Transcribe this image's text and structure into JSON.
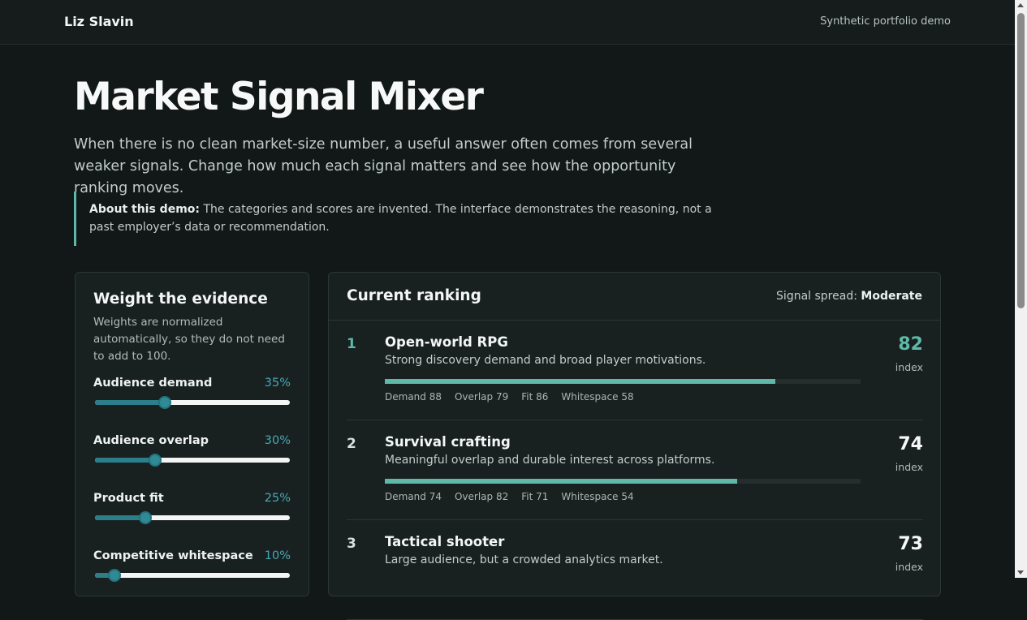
{
  "header": {
    "brand": "Liz Slavin",
    "tagline": "Synthetic portfolio demo"
  },
  "hero": {
    "title": "Market Signal Mixer",
    "lede": "When there is no clean market-size number, a useful answer often comes from several weaker signals. Change how much each signal matters and see how the opportunity ranking moves.",
    "note_label": "About this demo:",
    "note_text": " The categories and scores are invented. The interface demonstrates the reasoning, not a past employer’s data or recommendation."
  },
  "weights": {
    "title": "Weight the evidence",
    "description": "Weights are normalized automatically, so they do not need to add to 100.",
    "sliders": [
      {
        "label": "Audience demand",
        "pct_text": "35%",
        "level": 0.36
      },
      {
        "label": "Audience overlap",
        "pct_text": "30%",
        "level": 0.31
      },
      {
        "label": "Product fit",
        "pct_text": "25%",
        "level": 0.26
      },
      {
        "label": "Competitive whitespace",
        "pct_text": "10%",
        "level": 0.1
      }
    ]
  },
  "ranking": {
    "title": "Current ranking",
    "spread_label": "Signal spread: ",
    "spread_value": "Moderate",
    "index_label": "index",
    "items": [
      {
        "rank": "1",
        "name": "Open-world RPG",
        "description": "Strong discovery demand and broad player motivations.",
        "score": "82",
        "score_fraction": 0.82,
        "highlight": true,
        "metrics": [
          "Demand 88",
          "Overlap 79",
          "Fit 86",
          "Whitespace 58"
        ]
      },
      {
        "rank": "2",
        "name": "Survival crafting",
        "description": "Meaningful overlap and durable interest across platforms.",
        "score": "74",
        "score_fraction": 0.74,
        "highlight": false,
        "metrics": [
          "Demand 74",
          "Overlap 82",
          "Fit 71",
          "Whitespace 54"
        ]
      },
      {
        "rank": "3",
        "name": "Tactical shooter",
        "description": "Large audience, but a crowded analytics market.",
        "score": "73",
        "score_fraction": 0.73,
        "highlight": false,
        "metrics": []
      }
    ]
  },
  "colors": {
    "accent": "#5fb8a8",
    "slider_accent": "#2b7e8a",
    "pct_text": "#4aa7b6",
    "background": "#111817",
    "card": "#182120"
  }
}
